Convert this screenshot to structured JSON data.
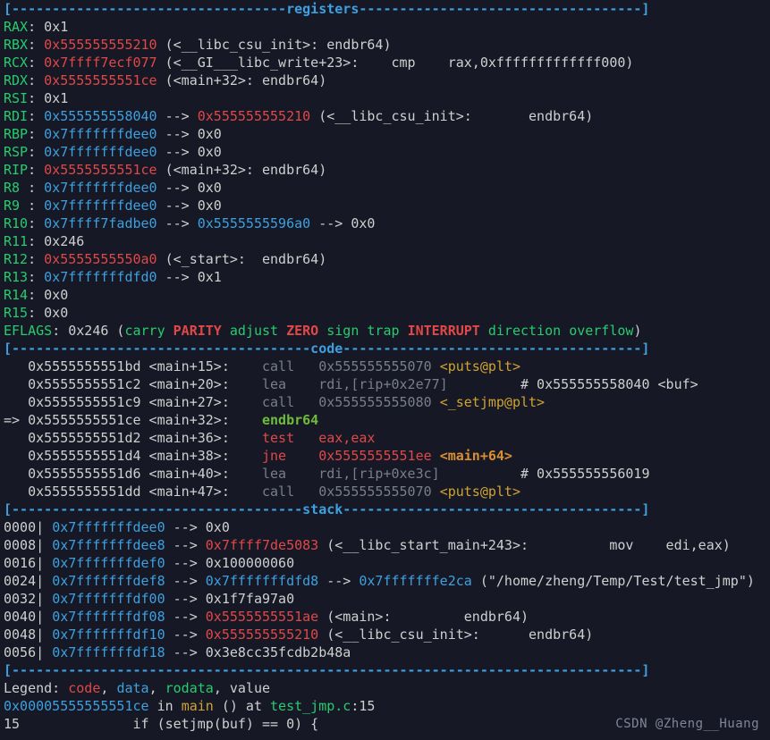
{
  "header_registers": {
    "left": "[----------------------------------",
    "title": "registers",
    "right": "-----------------------------------]"
  },
  "header_code": {
    "left": "[-------------------------------------",
    "title": "code",
    "right": "-------------------------------------]"
  },
  "header_stack": {
    "left": "[------------------------------------",
    "title": "stack",
    "right": "-------------------------------------]"
  },
  "header_end": {
    "full": "[------------------------------------------------------------------------------]"
  },
  "registers": {
    "RAX": {
      "name": "RAX",
      "val": "0x1"
    },
    "RBX": {
      "name": "RBX",
      "val": "0x555555555210",
      "anno": " (<__libc_csu_init>: endbr64)"
    },
    "RCX": {
      "name": "RCX",
      "val": "0x7ffff7ecf077",
      "anno": " (<__GI___libc_write+23>:    cmp    rax,0xfffffffffffff000)"
    },
    "RDX": {
      "name": "RDX",
      "val": "0x5555555551ce",
      "anno": " (<main+32>: endbr64)"
    },
    "RSI": {
      "name": "RSI",
      "val": "0x1"
    },
    "RDI": {
      "name": "RDI",
      "val": "0x555555558040",
      "arrow": " --> ",
      "val2": "0x555555555210",
      "anno": " (<__libc_csu_init>:       endbr64)"
    },
    "RBP": {
      "name": "RBP",
      "val": "0x7fffffffdee0",
      "arrow": " --> ",
      "anno": "0x0"
    },
    "RSP": {
      "name": "RSP",
      "val": "0x7fffffffdee0",
      "arrow": " --> ",
      "anno": "0x0"
    },
    "RIP": {
      "name": "RIP",
      "val": "0x5555555551ce",
      "anno": " (<main+32>: endbr64)"
    },
    "R8": {
      "name": "R8 ",
      "val": "0x7fffffffdee0",
      "arrow": " --> ",
      "anno": "0x0"
    },
    "R9": {
      "name": "R9 ",
      "val": "0x7fffffffdee0",
      "arrow": " --> ",
      "anno": "0x0"
    },
    "R10": {
      "name": "R10",
      "val": "0x7ffff7fadbe0",
      "arrow": " --> ",
      "val2": "0x5555555596a0",
      "arrow2": " --> ",
      "anno": "0x0"
    },
    "R11": {
      "name": "R11",
      "val": "0x246"
    },
    "R12": {
      "name": "R12",
      "val": "0x5555555550a0",
      "anno": " (<_start>:  endbr64)"
    },
    "R13": {
      "name": "R13",
      "val": "0x7fffffffdfd0",
      "arrow": " --> ",
      "anno": "0x1"
    },
    "R14": {
      "name": "R14",
      "val": "0x0"
    },
    "R15": {
      "name": "R15",
      "val": "0x0"
    }
  },
  "eflags": {
    "prefix": "EFLAGS",
    "value": "0x246",
    "open": " (",
    "f1": "carry ",
    "f2": "PARITY",
    "sp2": " ",
    "f3": "adjust ",
    "f4": "ZERO",
    "sp4": " ",
    "f5": "sign ",
    "f6": "trap ",
    "f7": "INTERRUPT",
    "sp7": " ",
    "f8": "direction ",
    "f9": "overflow",
    "close": ")"
  },
  "code": [
    {
      "cursor": "   ",
      "addr": "0x5555555551bd <main+15>:",
      "op": "    call   ",
      "t1": "0x555555555070 ",
      "t2": "<puts@plt>"
    },
    {
      "cursor": "   ",
      "addr": "0x5555555551c2 <main+20>:",
      "op": "    lea    ",
      "arg": "rdi,[rip+0x2e77]",
      "tail": "         # 0x555555558040 <buf>"
    },
    {
      "cursor": "   ",
      "addr": "0x5555555551c9 <main+27>:",
      "op": "    call   ",
      "t1": "0x555555555080 ",
      "t2": "<_setjmp@plt>"
    },
    {
      "cursor": "=> ",
      "addr": "0x5555555551ce <main+32>:",
      "opb": "    endbr64"
    },
    {
      "cursor": "   ",
      "addr": "0x5555555551d2 <main+36>:",
      "opred": "    test   eax,eax"
    },
    {
      "cursor": "   ",
      "addr": "0x5555555551d4 <main+38>:",
      "opred2": "    jne    ",
      "j1": "0x5555555551ee ",
      "j2": "<main+64>"
    },
    {
      "cursor": "   ",
      "addr": "0x5555555551d6 <main+40>:",
      "op": "    lea    ",
      "arg": "rdi,[rip+0xe3c]",
      "tail": "          # 0x555555556019"
    },
    {
      "cursor": "   ",
      "addr": "0x5555555551dd <main+47>:",
      "op": "    call   ",
      "t1": "0x555555555070 ",
      "t2": "<puts@plt>"
    }
  ],
  "stack": [
    {
      "off": "0000| ",
      "a": "0x7fffffffdee0",
      "arrow": " --> ",
      "tail": "0x0"
    },
    {
      "off": "0008| ",
      "a": "0x7fffffffdee8",
      "arrow": " --> ",
      "b": "0x7ffff7de5083",
      "anno": " (<__libc_start_main+243>:          mov    edi,eax)"
    },
    {
      "off": "0016| ",
      "a": "0x7fffffffdef0",
      "arrow": " --> ",
      "tail": "0x100000060"
    },
    {
      "off": "0024| ",
      "a": "0x7fffffffdef8",
      "arrow": " --> ",
      "b": "0x7fffffffdfd8",
      "arrow2": " --> ",
      "c": "0x7fffffffe2ca",
      "anno": " (\"/home/zheng/Temp/Test/test_jmp\")"
    },
    {
      "off": "0032| ",
      "a": "0x7fffffffdf00",
      "arrow": " --> ",
      "tail": "0x1f7fa97a0"
    },
    {
      "off": "0040| ",
      "a": "0x7fffffffdf08",
      "arrow": " --> ",
      "b": "0x5555555551ae",
      "anno": " (<main>:         endbr64)"
    },
    {
      "off": "0048| ",
      "a": "0x7fffffffdf10",
      "arrow": " --> ",
      "b": "0x555555555210",
      "anno": " (<__libc_csu_init>:      endbr64)"
    },
    {
      "off": "0056| ",
      "a": "0x7fffffffdf18",
      "arrow": " --> ",
      "tail": "0x3e8cc35fcdb2b48a"
    }
  ],
  "legend": {
    "prefix": "Legend: ",
    "code": "code",
    "c1": ", ",
    "data": "data",
    "c2": ", ",
    "rodata": "rodata",
    "c3": ", ",
    "value": "value"
  },
  "loc": {
    "addr": "0x00005555555551ce",
    "in": " in ",
    "fn": "main",
    "rest": " () at ",
    "file": "test_jmp.c",
    "colon": ":",
    "lineno": "15"
  },
  "src": {
    "no": "15",
    "pad": "              ",
    "text": "if (setjmp(buf) == 0) {"
  },
  "watermark": "CSDN @Zheng__Huang"
}
